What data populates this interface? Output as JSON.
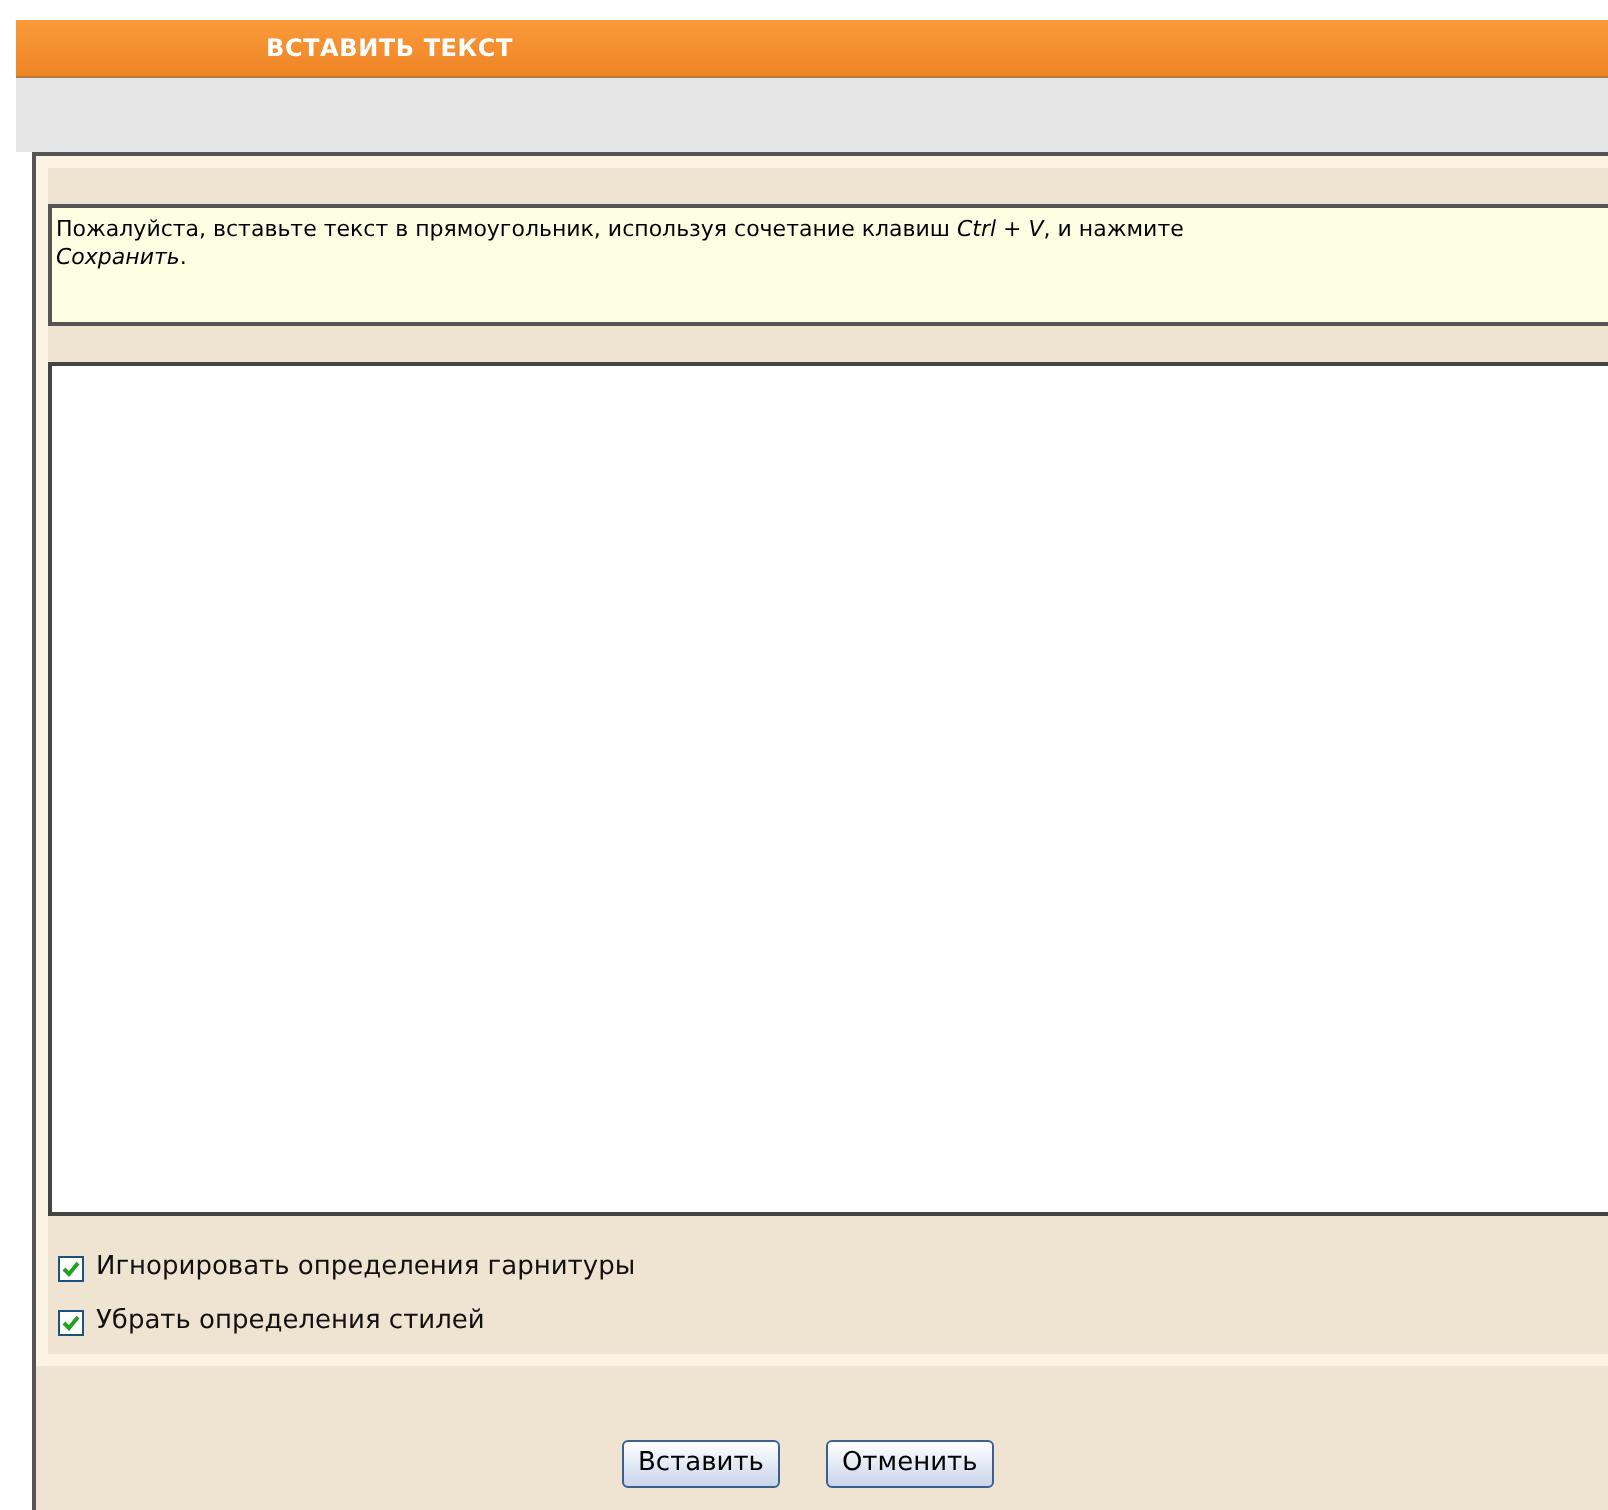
{
  "dialog": {
    "title": "ВСТАВИТЬ ТЕКСТ"
  },
  "instructions": "Пожалуйста, вставьте текст в прямоугольник, используя сочетание клавиш *Ctrl + V*, и нажмите *Сохранить*.",
  "options": [
    {
      "label": "Игнорировать определения гарнитуры",
      "checked": true
    },
    {
      "label": "Убрать определения стилей",
      "checked": true
    }
  ],
  "buttons": [
    "Вставить",
    "Отменить"
  ]
}
